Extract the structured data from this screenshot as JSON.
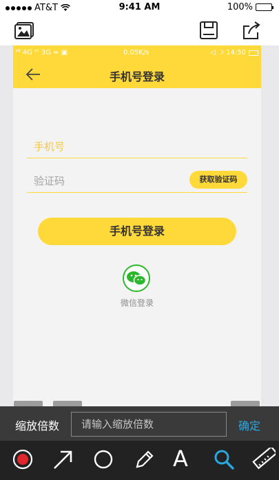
{
  "ios_status": {
    "carrier": "AT&T",
    "time": "9:41 AM",
    "battery": "100%",
    "battery_level": 1.0
  },
  "editor_toolbar": {
    "icons": [
      "image-icon",
      "save-icon",
      "share-icon"
    ]
  },
  "android_status": {
    "left": "ᴴᴵ 4G ᴴᴵ 3G ≈ ▣",
    "speed": "0.05K/s",
    "right": "◁ ☽ 14:50"
  },
  "app": {
    "title": "手机号登录",
    "back_icon": "back-arrow-icon",
    "phone_placeholder": "手机号",
    "code_placeholder": "验证码",
    "get_code_label": "获取验证码",
    "login_button_label": "手机号登录",
    "wechat_label": "微信登录"
  },
  "zoom_bar": {
    "label": "缩放倍数",
    "placeholder": "请输入缩放倍数",
    "value": "",
    "confirm_label": "确定"
  },
  "tools": {
    "items": [
      "record-dot-icon",
      "arrow-icon",
      "circle-icon",
      "pen-icon",
      "text-icon",
      "zoom-search-icon",
      "ruler-icon"
    ],
    "text_tool_label": "A",
    "active": "zoom-search-icon"
  },
  "colors": {
    "brand_yellow": "#ffd93a",
    "record_red": "#e0262c",
    "active_tool": "#2aa8e0",
    "wechat_green": "#2cb82c"
  }
}
